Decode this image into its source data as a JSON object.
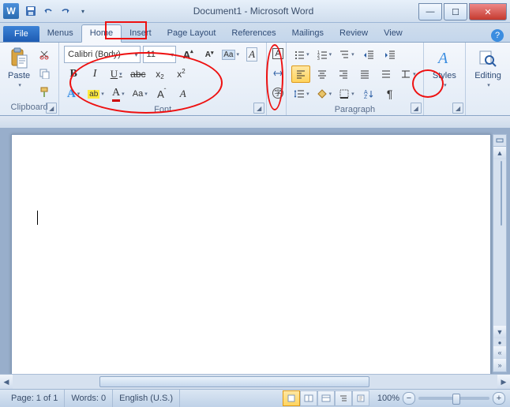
{
  "titlebar": {
    "app_letter": "W",
    "title": "Document1 - Microsoft Word"
  },
  "tabs": {
    "file": "File",
    "items": [
      "Menus",
      "Home",
      "Insert",
      "Page Layout",
      "References",
      "Mailings",
      "Review",
      "View"
    ],
    "active": "Home"
  },
  "ribbon": {
    "clipboard": {
      "label": "Clipboard",
      "paste": "Paste"
    },
    "font": {
      "label": "Font",
      "family": "Calibri (Body)",
      "size": "11",
      "bold": "B",
      "italic": "I",
      "underline": "U",
      "grow": "A",
      "shrink": "A",
      "change_case": "Aa",
      "clear_fmt": "A"
    },
    "paragraph": {
      "label": "Paragraph"
    },
    "styles": {
      "label": "Styles"
    },
    "editing": {
      "label": "Editing"
    }
  },
  "status": {
    "page": "Page: 1 of 1",
    "words": "Words: 0",
    "language": "English (U.S.)",
    "zoom": "100%"
  }
}
